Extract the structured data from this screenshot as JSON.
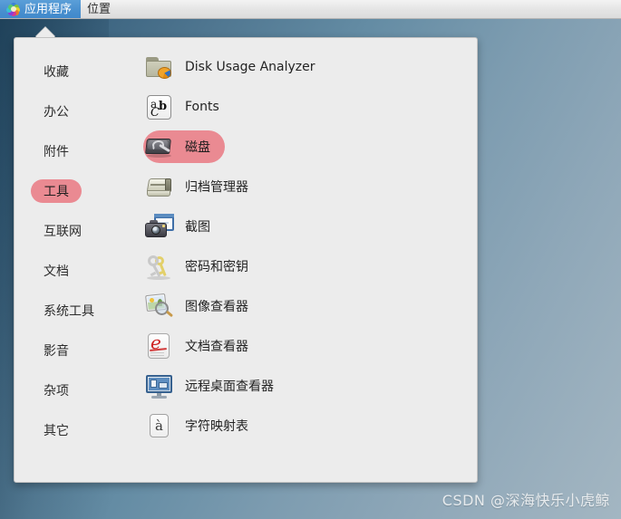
{
  "top_panel": {
    "applications_menu": {
      "label": "应用程序",
      "icon": "gnome-apps-starburst-icon",
      "active": true
    },
    "places_menu": {
      "label": "位置",
      "active": false
    }
  },
  "menu": {
    "categories": [
      {
        "label": "收藏",
        "selected": false
      },
      {
        "label": "办公",
        "selected": false
      },
      {
        "label": "附件",
        "selected": false
      },
      {
        "label": "工具",
        "selected": true
      },
      {
        "label": "互联网",
        "selected": false
      },
      {
        "label": "文档",
        "selected": false
      },
      {
        "label": "系统工具",
        "selected": false
      },
      {
        "label": "影音",
        "selected": false
      },
      {
        "label": "杂项",
        "selected": false
      },
      {
        "label": "其它",
        "selected": false
      }
    ],
    "applications": [
      {
        "label": "Disk Usage Analyzer",
        "icon": "folder-pie-chart-icon",
        "selected": false
      },
      {
        "label": "Fonts",
        "icon": "abc-font-icon",
        "selected": false
      },
      {
        "label": "磁盘",
        "icon": "hard-disk-wrench-icon",
        "selected": true
      },
      {
        "label": "归档管理器",
        "icon": "file-roller-archive-icon",
        "selected": false
      },
      {
        "label": "截图",
        "icon": "camera-screenshot-icon",
        "selected": false
      },
      {
        "label": "密码和密钥",
        "icon": "keys-icon",
        "selected": false
      },
      {
        "label": "图像查看器",
        "icon": "photo-magnifier-icon",
        "selected": false
      },
      {
        "label": "文档查看器",
        "icon": "evince-document-icon",
        "selected": false
      },
      {
        "label": "远程桌面查看器",
        "icon": "monitor-remote-icon",
        "selected": false
      },
      {
        "label": "字符映射表",
        "icon": "character-map-icon",
        "selected": false
      }
    ]
  },
  "watermark": {
    "text": "CSDN @深海快乐小虎鲸"
  },
  "colors": {
    "panel_background": "#ececec",
    "menubar_active": "#4a90cf",
    "selection_pink": "#ea8a92",
    "desktop_gradient_start": "#2e5570",
    "desktop_gradient_end": "#a3b6c2"
  }
}
